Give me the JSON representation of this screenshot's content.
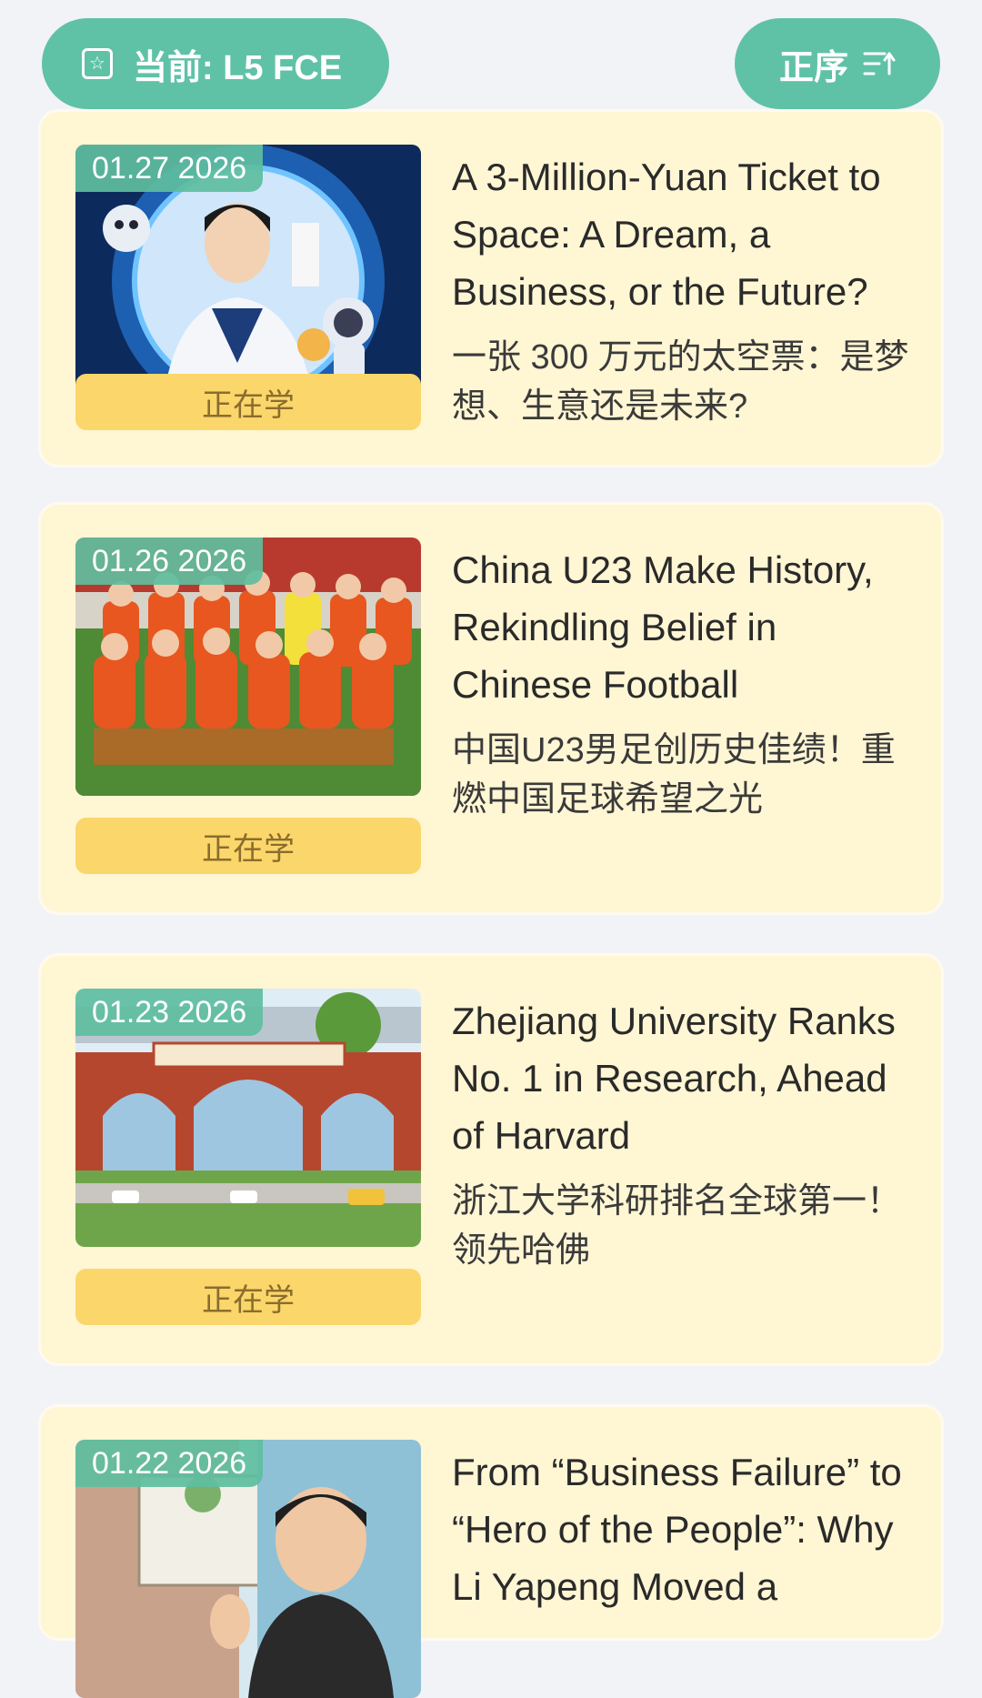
{
  "header": {
    "level_label": "当前: L5 FCE",
    "sort_label": "正序"
  },
  "articles": [
    {
      "date": "01.27 2026",
      "status": "正在学",
      "title_en": "A 3-Million-Yuan Ticket to Space: A Dream, a Business, or the Future?",
      "title_zh": "一张 300 万元的太空票：是梦想、生意还是未来?",
      "image": "astronaut-space-illustration"
    },
    {
      "date": "01.26 2026",
      "status": "正在学",
      "title_en": "China U23 Make History, Rekindling Belief in Chinese Football",
      "title_zh": "中国U23男足创历史佳绩！重燃中国足球希望之光",
      "image": "football-team-illustration"
    },
    {
      "date": "01.23 2026",
      "status": "正在学",
      "title_en": "Zhejiang University Ranks No. 1 in Research, Ahead of Harvard",
      "title_zh": "浙江大学科研排名全球第一！领先哈佛",
      "image": "university-gate-illustration"
    },
    {
      "date": "01.22 2026",
      "status": "",
      "title_en": "From “Business Failure” to “Hero of the People”: Why Li Yapeng Moved a",
      "title_zh": "",
      "image": "hospital-portrait-illustration"
    }
  ],
  "colors": {
    "accent": "#5fc2a7",
    "card_bg": "#fff6d4",
    "status_bg": "#fbd66a"
  }
}
